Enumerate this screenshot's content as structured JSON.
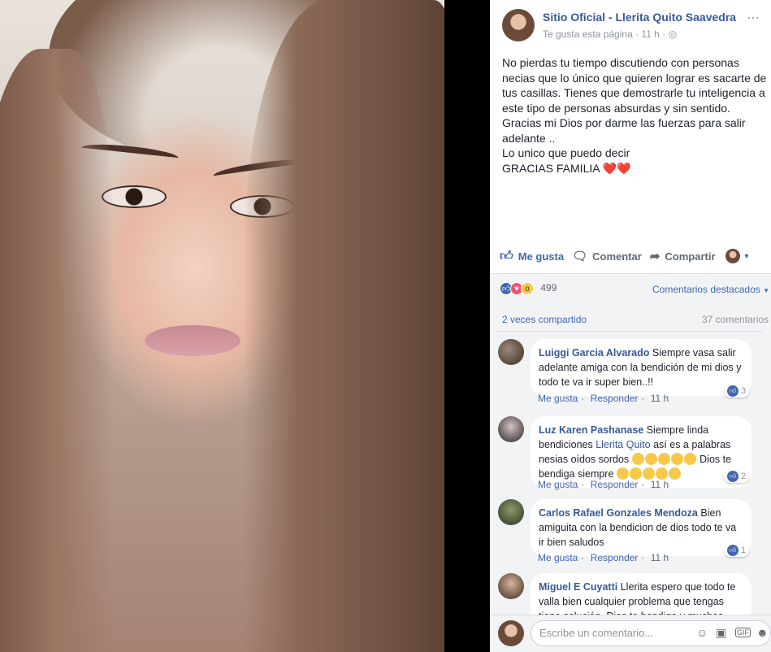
{
  "post": {
    "page_name": "Sitio Oficial - Llerita Quito Saavedra",
    "like_page": "Te gusta esta página",
    "time": "11 h",
    "text": "No pierdas tu tiempo discutiendo con personas necias que lo único que quieren lograr es sacarte de tus casillas. Tienes que demostrarle tu inteligencia a este tipo de personas absurdas y sin sentido.\nGracias mi Dios por darme las fuerzas para salir adelante ..\nLo unico que puedo decir\nGRACIAS FAMILIA ❤️❤️"
  },
  "actions": {
    "like": "Me gusta",
    "comment": "Comentar",
    "share": "Compartir"
  },
  "stats": {
    "reactions": "499",
    "sort": "Comentarios destacados",
    "shares": "2 veces compartido",
    "comments": "37 comentarios"
  },
  "comments": [
    {
      "author": "Luiggi Garcia Alvarado",
      "text": "Siempre vasa salir adelante amiga con la bendición de mi dios y todo te va ir super bien..!!",
      "likes": "3",
      "like": "Me gusta",
      "reply": "Responder",
      "time": "11 h"
    },
    {
      "author": "Luz Karen Pashanase",
      "text_a": "Siempre linda bendiciones",
      "mention": "Llerita Quito",
      "text_b": "así es a palabras nesias oídos sordos",
      "text_c": "Dios te bendiga siempre",
      "likes": "2",
      "like": "Me gusta",
      "reply": "Responder",
      "time": "11 h"
    },
    {
      "author": "Carlos Rafael Gonzales Mendoza",
      "text": "Bien amiguita con la bendicion de dios todo te va ir bien saludos",
      "likes": "1",
      "like": "Me gusta",
      "reply": "Responder",
      "time": "11 h"
    },
    {
      "author": "Miguel E Cuyatti",
      "text": "Llerita espero que todo te valla bien cualquier problema que tengas tiene solución. Dios te bendiga y muchos"
    }
  ],
  "composer": {
    "placeholder": "Escribe un comentario..."
  },
  "colors": {
    "link": "#385898",
    "accent": "#4267b2",
    "background": "#f2f3f5"
  }
}
